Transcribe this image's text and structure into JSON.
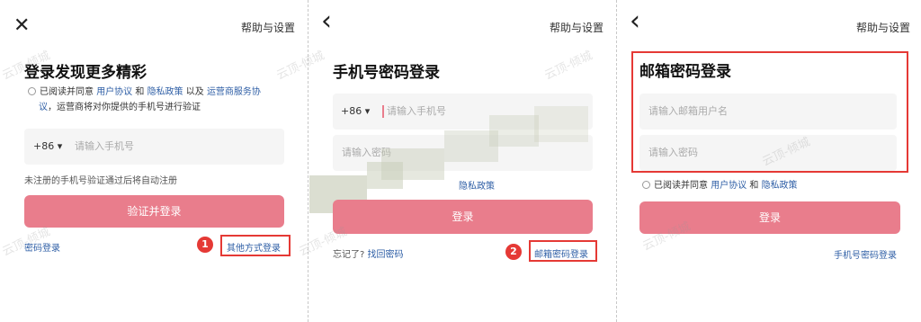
{
  "panel1": {
    "close_icon": "✕",
    "help": "帮助与设置",
    "title": "登录发现更多精彩",
    "agree_prefix": "已阅读并同意",
    "user_agreement": "用户协议",
    "and": "和",
    "privacy_policy": "隐私政策",
    "also": "以及",
    "carrier_agreement_1": "运营商服务协",
    "carrier_agreement_2": "议",
    "agree_suffix": "，运营商将对你提供的手机号进行验证",
    "country_code": "+86 ▾",
    "phone_placeholder": "请输入手机号",
    "auto_register_note": "未注册的手机号验证通过后将自动注册",
    "verify_button": "验证并登录",
    "password_login": "密码登录",
    "other_login": "其他方式登录",
    "badge": "1"
  },
  "panel2": {
    "back_icon": "‹",
    "help": "帮助与设置",
    "title": "手机号密码登录",
    "country_code": "+86 ▾",
    "phone_placeholder": "请输入手机号",
    "password_placeholder": "请输入密码",
    "privacy_policy": "隐私政策",
    "login_button": "登录",
    "forgot": "忘记了?",
    "recover": "找回密码",
    "email_login": "邮箱密码登录",
    "badge": "2"
  },
  "panel3": {
    "back_icon": "‹",
    "help": "帮助与设置",
    "title": "邮箱密码登录",
    "email_placeholder": "请输入邮箱用户名",
    "password_placeholder": "请输入密码",
    "agree_prefix": "已阅读并同意",
    "user_agreement": "用户协议",
    "and": "和",
    "privacy_policy": "隐私政策",
    "login_button": "登录",
    "phone_login": "手机号密码登录"
  },
  "watermark": "云顶-倾城",
  "colors": {
    "accent": "#e97d8c",
    "link": "#2f5fa6",
    "highlight": "#e53935"
  }
}
